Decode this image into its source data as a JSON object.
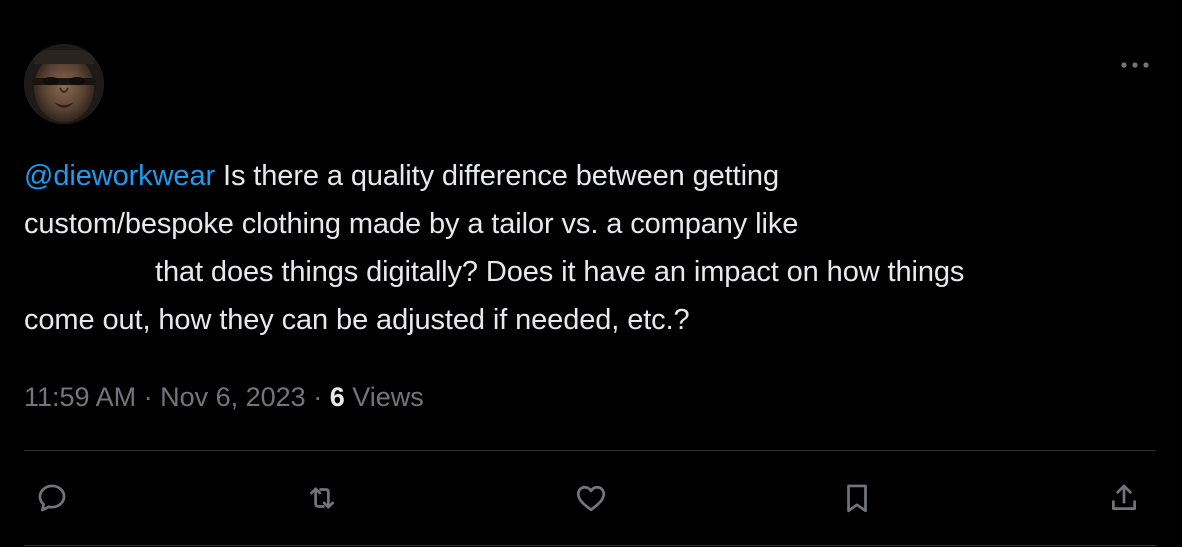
{
  "tweet": {
    "mention": "@dieworkwear",
    "line1_rest": " Is there a quality difference between getting",
    "line2": "custom/bespoke clothing made by a tailor vs. a company like",
    "line3": "that does things digitally? Does it have an impact on how things",
    "line4": "come out, how they can be adjusted if needed, etc.?"
  },
  "meta": {
    "time": "11:59 AM",
    "separator1": " · ",
    "date": "Nov 6, 2023",
    "separator2": " · ",
    "views_count": "6",
    "views_label": " Views"
  },
  "icons": {
    "more": "more-horizontal-icon",
    "reply": "reply-icon",
    "retweet": "retweet-icon",
    "like": "heart-icon",
    "bookmark": "bookmark-icon",
    "share": "share-icon"
  },
  "colors": {
    "background": "#000000",
    "text": "#e7e9ea",
    "secondary": "#71767b",
    "accent": "#1d9bf0",
    "divider": "#2f3336"
  }
}
